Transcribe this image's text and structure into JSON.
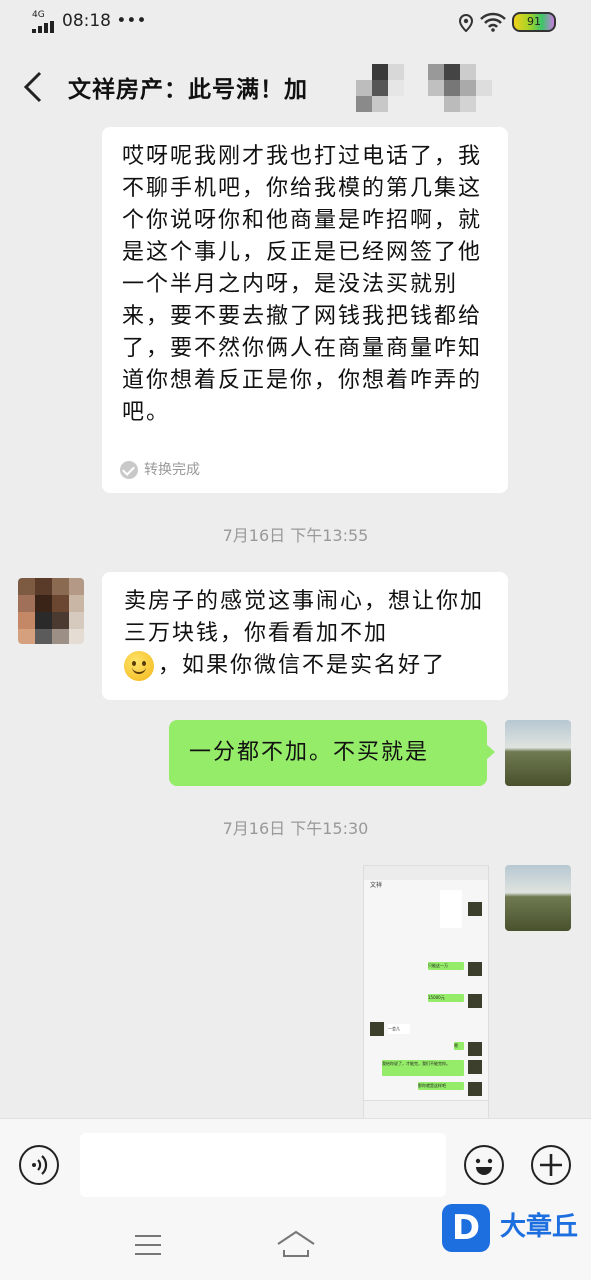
{
  "status_bar": {
    "network": "4G",
    "time": "08:18",
    "more": "•••",
    "battery": "91"
  },
  "header": {
    "title": "文祥房产：此号满！加"
  },
  "messages": {
    "voice_transcript": "哎呀呢我刚才我也打过电话了，我不聊手机吧，你给我模的第几集这个你说呀你和他商量是咋招啊，就是这个事儿，反正是已经网签了他一个半月之内呀，是没法买就别来，要不要去撤了网钱我把钱都给了，要不然你俩人在商量商量咋知道你想着反正是你，你想着咋弄的吧。",
    "convert_status": "转换完成",
    "time_1": "7月16日  下午13:55",
    "incoming_text_before_emoji": "卖房子的感觉这事闹心，想让你加三万块钱，你看看加不加",
    "incoming_text_after_emoji": "，如果你微信不是实名好了",
    "emoji_icon": "slightly-smiling-face-icon",
    "outgoing_text": "一分都不加。不买就是",
    "time_2": "7月16日  下午15:30",
    "screenshot_thumbnail": {
      "contact": "文祥",
      "lines": [
        "只能这一万",
        "15000元",
        "一会儿",
        "嗯",
        "我给你说了，才能完，我们不能完你。",
        "那你就是这样吧"
      ]
    }
  },
  "colors": {
    "outgoing_bubble": "#95ec69",
    "background": "#ededed",
    "watermark": "#1d6fe0"
  },
  "watermark": {
    "brand": "大章丘",
    "logo_letter": "D"
  }
}
